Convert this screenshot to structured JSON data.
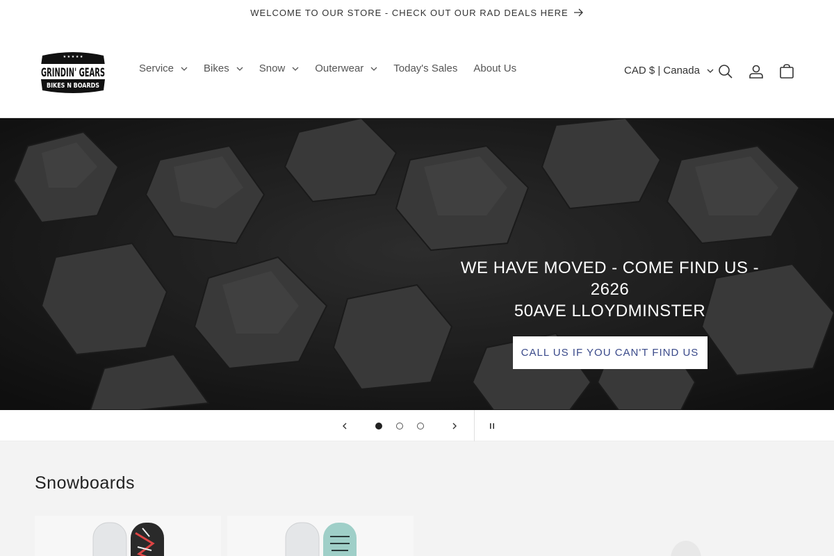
{
  "announcement": {
    "text": "WELCOME TO OUR STORE - CHECK OUT OUR RAD DEALS HERE"
  },
  "logo": {
    "line1": "GRINDIN' GEARS",
    "line2": "BIKES N BOARDS"
  },
  "nav": {
    "items": [
      {
        "label": "Service",
        "dropdown": true
      },
      {
        "label": "Bikes",
        "dropdown": true
      },
      {
        "label": "Snow",
        "dropdown": true
      },
      {
        "label": "Outerwear",
        "dropdown": true
      },
      {
        "label": "Today's Sales",
        "dropdown": false
      },
      {
        "label": "About Us",
        "dropdown": false
      }
    ]
  },
  "header": {
    "currency": "CAD $ | Canada",
    "icons": [
      "search-icon",
      "account-icon",
      "cart-icon"
    ]
  },
  "hero": {
    "heading_line1": "WE HAVE MOVED - COME FIND US - 2626",
    "heading_line2": "50AVE LLOYDMINSTER",
    "button_label": "CALL US IF YOU CAN'T FIND US"
  },
  "slideshow": {
    "slide_count": 3,
    "active_slide": 1,
    "icons": [
      "chevron-left-icon",
      "chevron-right-icon",
      "pause-icon"
    ]
  },
  "collection": {
    "title": "Snowboards"
  },
  "colors": {
    "button_text": "#3a4a8a",
    "hero_bg": "#2a2a2a",
    "section_bg": "#f3f3f3"
  }
}
